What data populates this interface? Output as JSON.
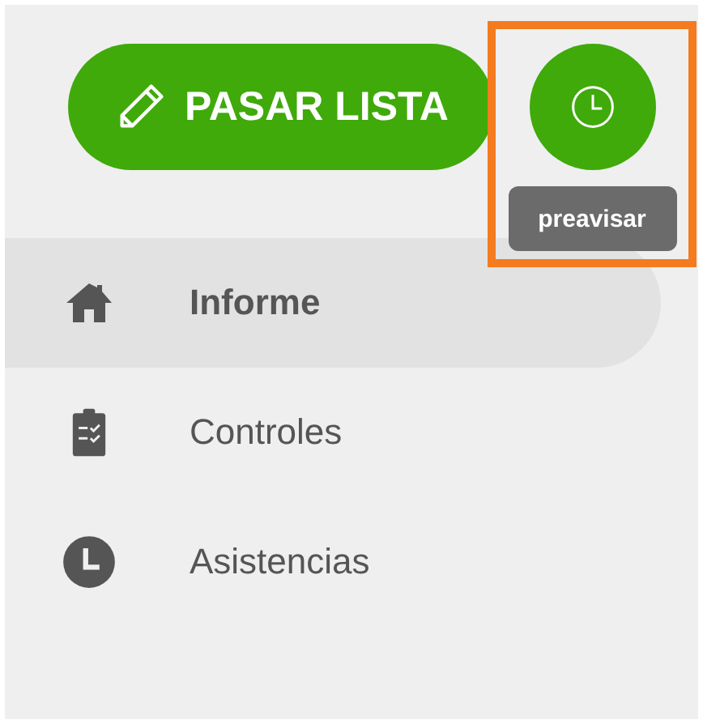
{
  "primary_button": {
    "label": "PASAR LISTA"
  },
  "clock_button": {
    "highlighted": true,
    "tooltip": "preavisar"
  },
  "nav": [
    {
      "kind": "home",
      "label": "Informe",
      "selected": true
    },
    {
      "kind": "clipboard",
      "label": "Controles",
      "selected": false
    },
    {
      "kind": "clock",
      "label": "Asistencias",
      "selected": false
    }
  ]
}
